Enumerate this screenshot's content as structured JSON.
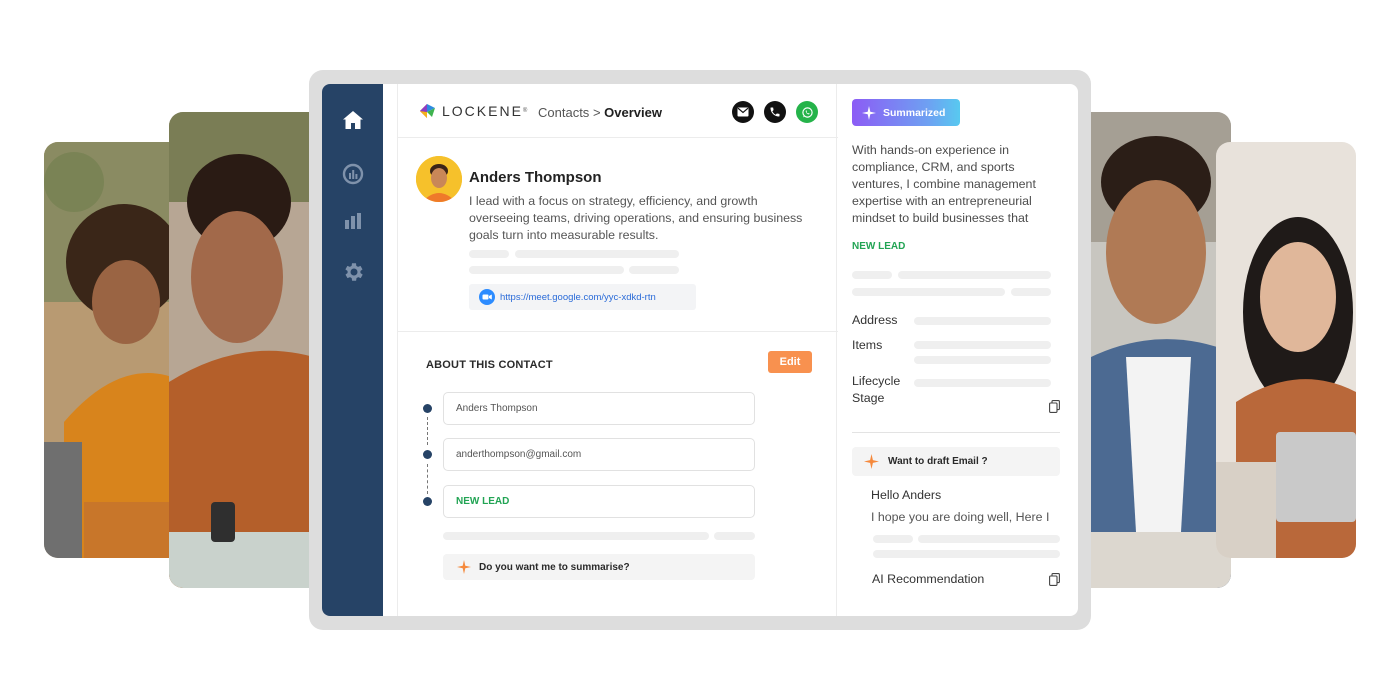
{
  "app": {
    "logo_text": "LOCKENE",
    "logo_mark": "®"
  },
  "breadcrumb": {
    "parent": "Contacts",
    "separator": ">",
    "current": "Overview"
  },
  "header_actions": [
    {
      "name": "email-icon",
      "color": "#111111"
    },
    {
      "name": "phone-icon",
      "color": "#111111"
    },
    {
      "name": "whatsapp-icon",
      "color": "#25b34a"
    }
  ],
  "sidebar": {
    "items": [
      {
        "icon": "home-icon"
      },
      {
        "icon": "analytics-icon"
      },
      {
        "icon": "bar-chart-icon"
      },
      {
        "icon": "settings-icon"
      }
    ]
  },
  "profile": {
    "name": "Anders Thompson",
    "bio": "I lead with a focus on strategy, efficiency, and growth overseeing teams, driving operations, and ensuring business goals turn into measurable results.",
    "meeting_link": "https://meet.google.com/yyc-xdkd-rtn",
    "meeting_icon": "video-call-icon"
  },
  "about": {
    "title": "ABOUT THIS CONTACT",
    "edit_label": "Edit",
    "fields": [
      {
        "value": "Anders Thompson"
      },
      {
        "value": "anderthompson@gmail.com"
      },
      {
        "value": "NEW LEAD"
      }
    ],
    "summarise_prompt": "Do you want me to summarise?"
  },
  "summary_panel": {
    "badge": "Summarized",
    "text": "With hands-on experience in compliance, CRM, and sports ventures, I combine management expertise with an entrepreneurial mindset to build businesses that",
    "status": "NEW LEAD",
    "labels": {
      "address": "Address",
      "items": "Items",
      "lifecycle_line1": "Lifecycle",
      "lifecycle_line2": "Stage"
    },
    "draft_prompt": "Want to draft Email ?",
    "email_greeting": "Hello Anders",
    "email_body": "I hope you are doing well, Here I",
    "ai_recommendation": "AI Recommendation"
  },
  "colors": {
    "sidebar": "#264366",
    "accent_orange": "#f8914f",
    "lead_green": "#22a454",
    "link_blue": "#2a6bd8"
  }
}
